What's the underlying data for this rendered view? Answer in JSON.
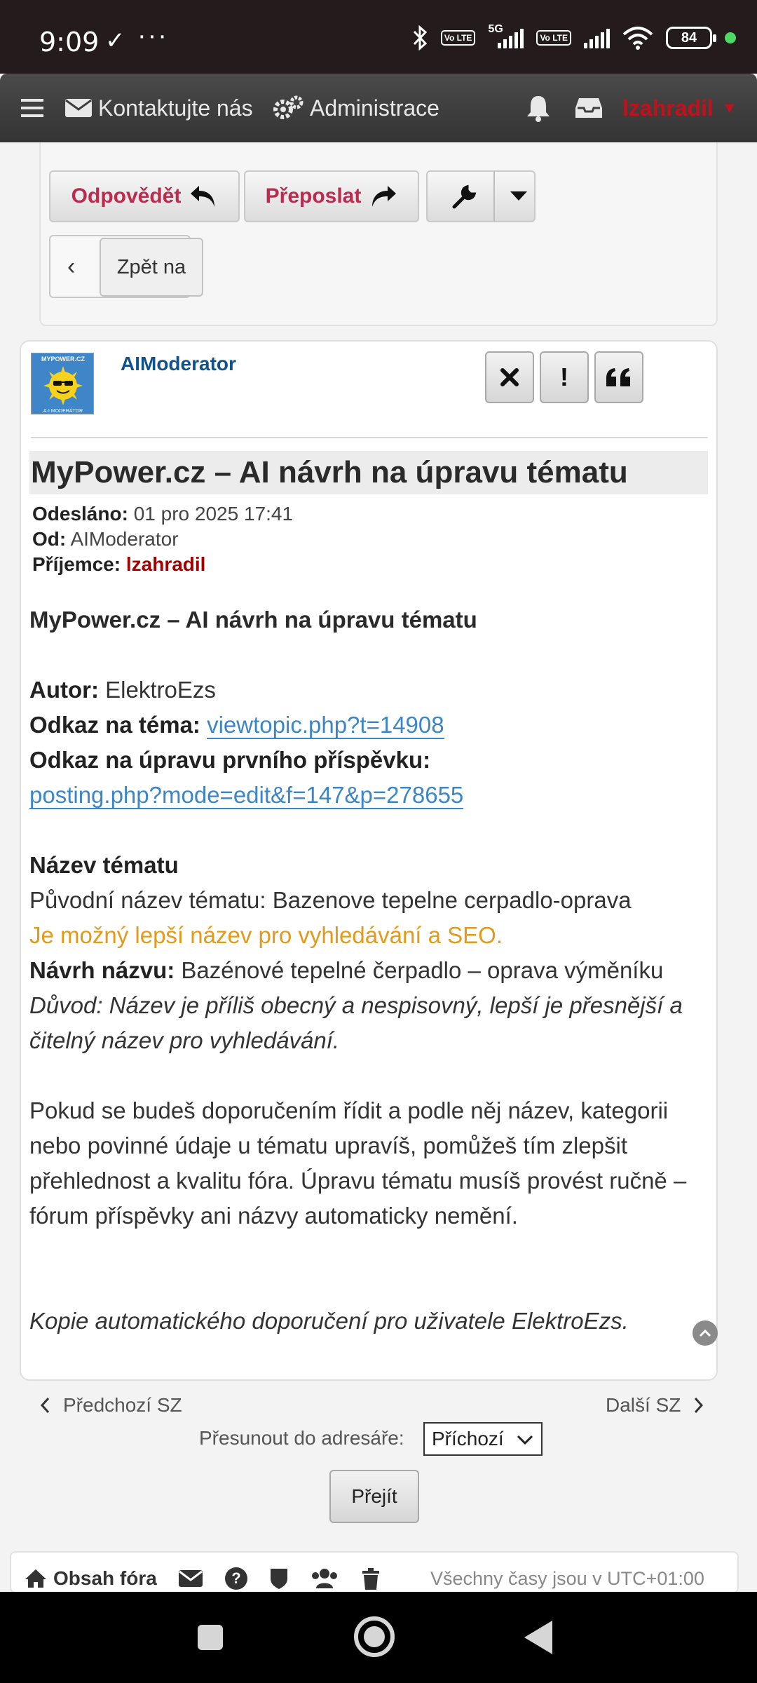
{
  "status_bar": {
    "time": "9:09",
    "check": "✓",
    "dots": "···",
    "volte1": "Vo LTE",
    "net": "5G",
    "volte2": "Vo LTE",
    "battery": "84"
  },
  "navbar": {
    "contact": "Kontaktujte nás",
    "admin": "Administrace",
    "user": "lzahradil"
  },
  "actions": {
    "reply": "Odpovědět",
    "forward": "Přeposlat",
    "back_label": "Zpět na"
  },
  "message": {
    "avatar_text_top": "MYPOWER.CZ",
    "avatar_text_bottom": "A·I MODERÁTOR",
    "author": "AIModerator",
    "title": "MyPower.cz – AI návrh na úpravu tématu",
    "sent_label": "Odesláno:",
    "sent_value": "01 pro 2025 17:41",
    "from_label": "Od:",
    "from_value": "AIModerator",
    "recipient_label": "Příjemce:",
    "recipient_value": "lzahradil",
    "body_heading": "MyPower.cz – AI návrh na úpravu tématu",
    "author_label": "Autor:",
    "author_value": "ElektroEzs",
    "topic_link_label": "Odkaz na téma:",
    "topic_link": "viewtopic.php?t=14908",
    "edit_link_label": "Odkaz na úpravu prvního příspěvku:",
    "edit_link": "posting.php?mode=edit&f=147&p=278655",
    "section_title": "Název tématu",
    "original_title": "Původní název tématu: Bazenove tepelne cerpadlo-oprava",
    "better_title_note": "Je možný lepší název pro vyhledávání a SEO.",
    "suggestion_label": "Návrh názvu:",
    "suggestion_value": "Bazénové tepelné čerpadlo – oprava výměníku",
    "reason": "Důvod: Název je příliš obecný a nespisovný, lepší je přesnější a čitelný název pro vyhledávání.",
    "advice": "Pokud se budeš doporučením řídit a podle něj název, kategorii nebo povinné údaje u tématu upravíš, pomůžeš tím zlepšit přehlednost a kvalitu fóra. Úpravu tématu musíš provést ručně – fórum příspěvky ani názvy automaticky nemění.",
    "copy_note": "Kopie automatického doporučení pro uživatele ElektroEzs."
  },
  "pagination": {
    "prev": "Předchozí SZ",
    "next": "Další SZ",
    "move_label": "Přesunout do adresáře:",
    "folder_selected": "Příchozí",
    "go": "Přejít"
  },
  "footer": {
    "index": "Obsah fóra",
    "timezone": "Všechny časy jsou v UTC+01:00"
  },
  "colors": {
    "accent_red": "#bc2a4d",
    "link_blue": "#3d86c6",
    "author_blue": "#105289",
    "warning_orange": "#e29a1c",
    "navbar_bg": "#3d3d3d"
  }
}
